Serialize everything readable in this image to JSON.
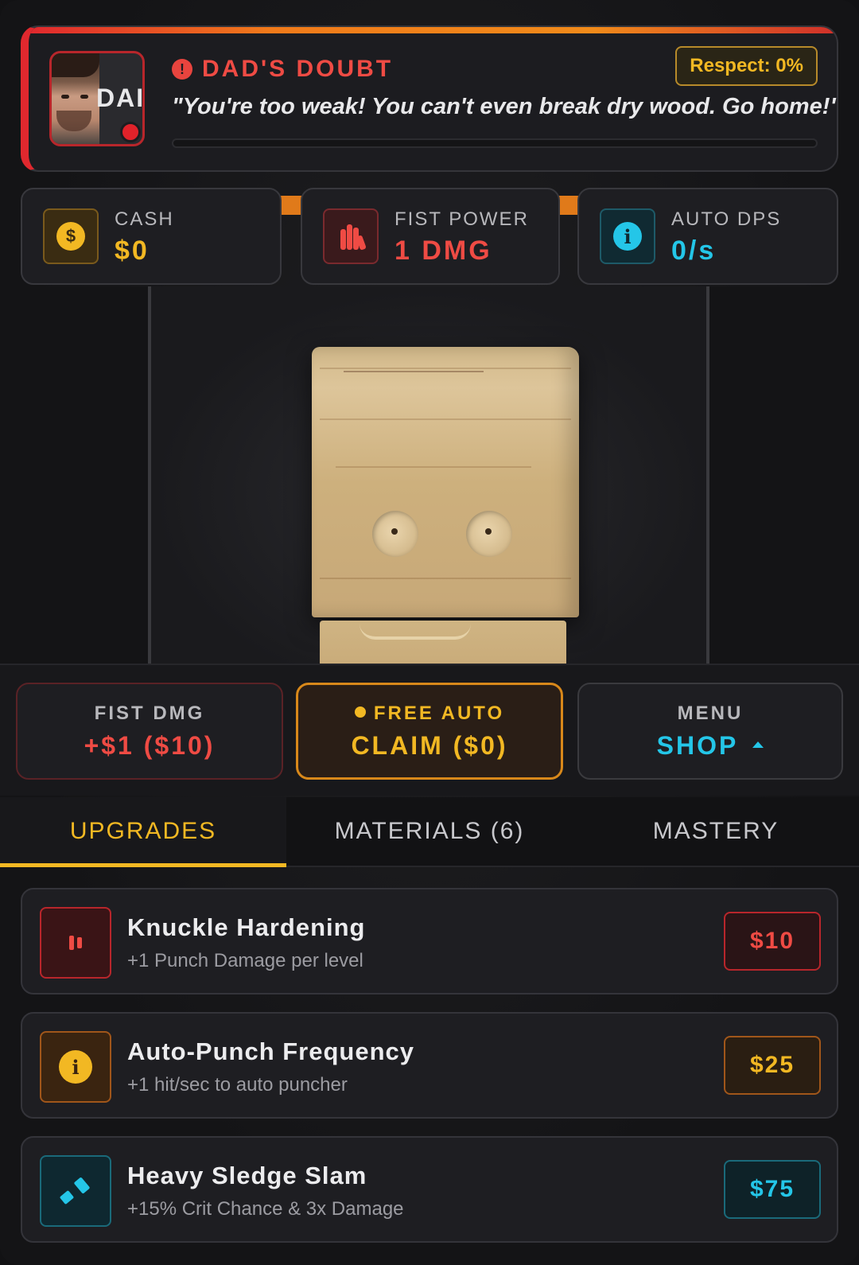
{
  "dad": {
    "avatar_text": "DAI",
    "title": "DAD'S DOUBT",
    "respect_label": "Respect: 0%",
    "respect_progress": 0,
    "quote": "\"You're too weak! You can't even break dry wood. Go home!\""
  },
  "stats": {
    "cash": {
      "label": "CASH",
      "value": "$0",
      "icon": "dollar-coin-icon"
    },
    "fist_power": {
      "label": "FIST POWER",
      "value": "1 DMG",
      "icon": "fist-icon"
    },
    "auto_dps": {
      "label": "AUTO DPS",
      "value": "0/s",
      "icon": "info-icon"
    }
  },
  "actions": {
    "fist_dmg": {
      "small": "FIST DMG",
      "big": "+$1 ($10)"
    },
    "claim": {
      "small": "FREE AUTO",
      "big": "CLAIM ($0)"
    },
    "menu": {
      "small": "MENU",
      "big": "SHOP"
    }
  },
  "tabs": [
    {
      "label": "UPGRADES",
      "active": true
    },
    {
      "label": "MATERIALS (6)",
      "active": false
    },
    {
      "label": "MASTERY",
      "active": false
    }
  ],
  "upgrades": [
    {
      "name": "Knuckle Hardening",
      "desc": "+1 Punch Damage per level",
      "price": "$10",
      "icon": "fist-icon",
      "color": "#ef4b44"
    },
    {
      "name": "Auto-Punch Frequency",
      "desc": "+1 hit/sec to auto puncher",
      "price": "$25",
      "icon": "info-icon",
      "color": "#f2b823"
    },
    {
      "name": "Heavy Sledge Slam",
      "desc": "+15% Crit Chance & 3x Damage",
      "price": "$75",
      "icon": "hammer-icon",
      "color": "#24c6e8"
    }
  ]
}
